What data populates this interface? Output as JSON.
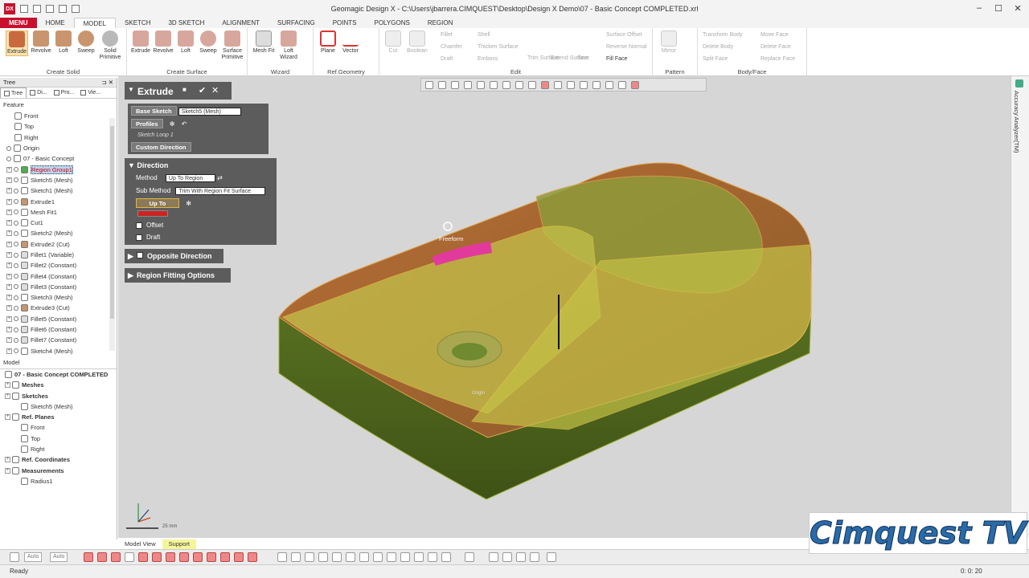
{
  "app": {
    "logo": "DX",
    "title": "Geomagic Design X - C:\\Users\\jbarrera.CIMQUEST\\Desktop\\Design X Demo\\07 - Basic Concept COMPLETED.xrl"
  },
  "window": {
    "minimize": "–",
    "maximize": "☐",
    "close": "✕"
  },
  "ribbon_tabs": [
    "MENU",
    "HOME",
    "MODEL",
    "SKETCH",
    "3D SKETCH",
    "ALIGNMENT",
    "SURFACING",
    "POINTS",
    "POLYGONS",
    "REGION"
  ],
  "ribbon": {
    "create_solid": {
      "label": "Create Solid",
      "buttons": [
        "Extrude",
        "Revolve",
        "Loft",
        "Sweep",
        "Solid Primitive"
      ]
    },
    "create_surface": {
      "label": "Create Surface",
      "buttons": [
        "Extrude",
        "Revolve",
        "Loft",
        "Sweep",
        "Surface Primitive"
      ]
    },
    "wizard": {
      "label": "Wizard",
      "buttons": [
        "Mesh Fit",
        "Loft Wizard"
      ]
    },
    "ref_geometry": {
      "label": "Ref.Geometry",
      "buttons": [
        "Plane",
        "Vector"
      ]
    },
    "edit": {
      "label": "Edit",
      "buttons": [
        "Cut",
        "Boolean"
      ],
      "small": [
        "Fillet",
        "Chamfer",
        "Draft",
        "Shell",
        "Thicken Surface",
        "Emboss",
        "Trim Surface",
        "Extend Surface",
        "Sew",
        "Surface Offset",
        "Reverse Normal",
        "Fill Face"
      ]
    },
    "pattern": {
      "label": "Pattern",
      "buttons": [
        "Mirror"
      ]
    },
    "body_face": {
      "label": "Body/Face",
      "small": [
        "Transform Body",
        "Delete Body",
        "Split Face",
        "Move Face",
        "Delete Face",
        "Replace Face"
      ]
    }
  },
  "tree": {
    "title": "Tree",
    "tabs": [
      "Tree",
      "Di...",
      "Pro...",
      "Vie..."
    ],
    "feature_label": "Feature",
    "features": [
      "Front",
      "Top",
      "Right",
      "Origin",
      "07 - Basic Concept",
      "Region Group1",
      "Sketch5 (Mesh)",
      "Sketch1 (Mesh)",
      "Extrude1",
      "Mesh Fit1",
      "Cut1",
      "Sketch2 (Mesh)",
      "Extrude2 (Cut)",
      "Fillet1 (Variable)",
      "Fillet2 (Constant)",
      "Fillet4 (Constant)",
      "Fillet3 (Constant)",
      "Sketch3 (Mesh)",
      "Extrude3 (Cut)",
      "Fillet5 (Constant)",
      "Fillet6 (Constant)",
      "Fillet7 (Constant)",
      "Sketch4 (Mesh)"
    ],
    "model_label": "Model",
    "model": [
      "07 - Basic Concept COMPLETED",
      "Meshes",
      "Sketches",
      "Sketch5 (Mesh)",
      "Ref. Planes",
      "Front",
      "Top",
      "Right",
      "Ref. Coordinates",
      "Measurements",
      "Radius1"
    ]
  },
  "extrude": {
    "title": "Extrude",
    "base_sketch_label": "Base Sketch",
    "base_sketch_value": "Sketch5 (Mesh)",
    "profiles_label": "Profiles",
    "sketch_loop": "Sketch Loop 1",
    "custom_direction_label": "Custom Direction",
    "direction_label": "Direction",
    "method_label": "Method",
    "method_value": "Up To Region",
    "submethod_label": "Sub Method",
    "submethod_value": "Trim With Region Fit Surface",
    "up_to_label": "Up To",
    "offset_label": "Offset",
    "draft_label": "Draft",
    "opposite_label": "Opposite Direction",
    "region_fitting_label": "Region Fitting Options"
  },
  "viewport": {
    "freeform_label": "Freeform",
    "origin_label": "Origin",
    "scale_label": "25 mm"
  },
  "bottom_tabs": [
    "Model View",
    "Support"
  ],
  "toolbar2": {
    "combo1": "Auto",
    "combo2": "Auto"
  },
  "status": {
    "text": "Ready",
    "right": "0: 0: 20"
  },
  "side_panel": {
    "label": "Accuracy Analyzer(TM)"
  },
  "watermark": "Cimquest TV",
  "colors": {
    "menu_red": "#c8102e",
    "model_orange": "#c07a3a",
    "face_green": "#8aa83f",
    "region_yellow": "#d8d24a",
    "highlight_pink": "#e23a9c",
    "watermark_blue": "#2a6aa8"
  }
}
